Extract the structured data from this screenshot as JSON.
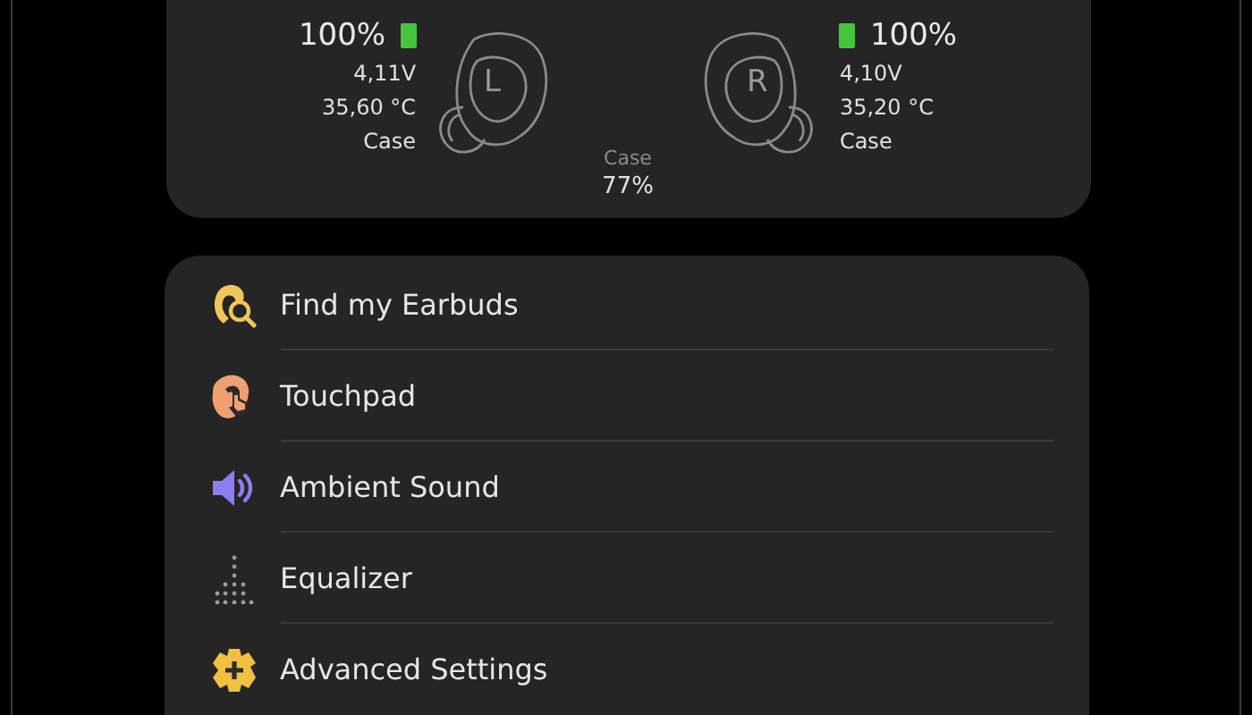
{
  "earbuds": {
    "left": {
      "battery": "100%",
      "voltage": "4,11V",
      "temperature": "35,60 °C",
      "location": "Case",
      "letter": "L"
    },
    "right": {
      "battery": "100%",
      "voltage": "4,10V",
      "temperature": "35,20 °C",
      "location": "Case",
      "letter": "R"
    },
    "case": {
      "label": "Case",
      "battery": "77%"
    }
  },
  "menu": [
    {
      "kind": "find",
      "label": "Find my Earbuds"
    },
    {
      "kind": "touchpad",
      "label": "Touchpad"
    },
    {
      "kind": "ambient",
      "label": "Ambient Sound"
    },
    {
      "kind": "equalizer",
      "label": "Equalizer"
    },
    {
      "kind": "advanced",
      "label": "Advanced Settings"
    }
  ]
}
